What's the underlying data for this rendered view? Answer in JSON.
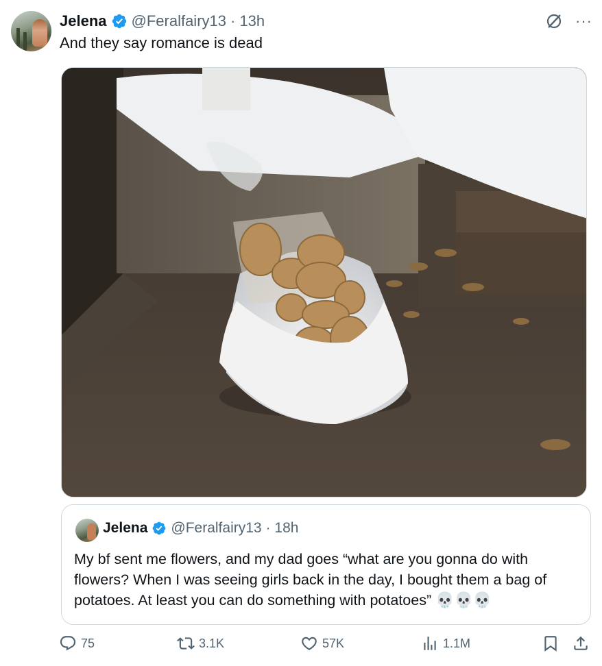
{
  "author": {
    "name": "Jelena",
    "handle": "@Feralfairy13",
    "time": "· 13h"
  },
  "tweet": {
    "text": "And they say romance is dead"
  },
  "header_icons": {
    "grok": "grok-icon",
    "more": "···"
  },
  "quoted_tweet": {
    "name": "Jelena",
    "handle": "@Feralfairy13",
    "time": "· 18h",
    "text": "My bf sent me flowers, and my dad goes “what are you gonna do with flowers? When I was seeing girls back in the day, I bought them a bag of potatoes. At least you can do something with potatoes”",
    "emoji": "💀💀💀"
  },
  "actions": {
    "replies": "75",
    "reposts": "3.1K",
    "likes": "57K",
    "views": "1.1M"
  },
  "colors": {
    "verified": "#1d9bf0",
    "secondary_text": "#536471",
    "border": "#cfd9de"
  }
}
